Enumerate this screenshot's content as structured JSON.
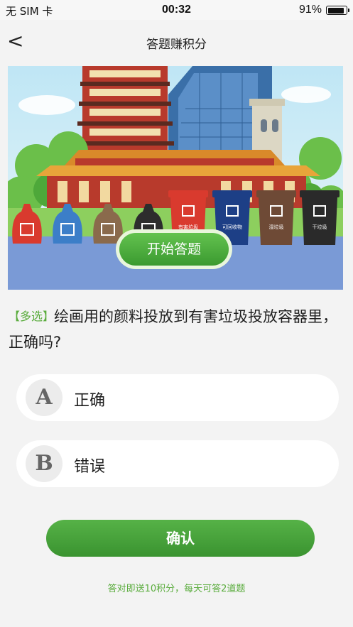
{
  "status_bar": {
    "carrier": "无 SIM 卡",
    "time": "00:32",
    "battery": "91%",
    "battery_level": 0.91
  },
  "nav": {
    "back_icon": "chevron-left-icon",
    "back_glyph": "<",
    "title": "答题赚积分"
  },
  "banner": {
    "start_label": "开始答题",
    "bins": [
      {
        "label": "有害垃圾",
        "color": "#d93a2e"
      },
      {
        "label": "可回收物",
        "color": "#1d3f86"
      },
      {
        "label": "湿垃圾",
        "color": "#6e4a36"
      },
      {
        "label": "干垃圾",
        "color": "#2a2a2a"
      }
    ],
    "bags": [
      {
        "color": "#d93a2e"
      },
      {
        "color": "#3c7ec8"
      },
      {
        "color": "#8a6a4c"
      },
      {
        "color": "#2d2d2d"
      }
    ]
  },
  "question": {
    "tag": "【多选】",
    "text": "绘画用的颜料投放到有害垃圾投放容器里，正确吗?"
  },
  "options": [
    {
      "letter": "A",
      "text": "正确"
    },
    {
      "letter": "B",
      "text": "错误"
    }
  ],
  "confirm_label": "确认",
  "note": "答对即送10积分，每天可答2道题",
  "colors": {
    "accent": "#5aac3d",
    "button": "#4aa83c",
    "background": "#f3f3f3"
  }
}
